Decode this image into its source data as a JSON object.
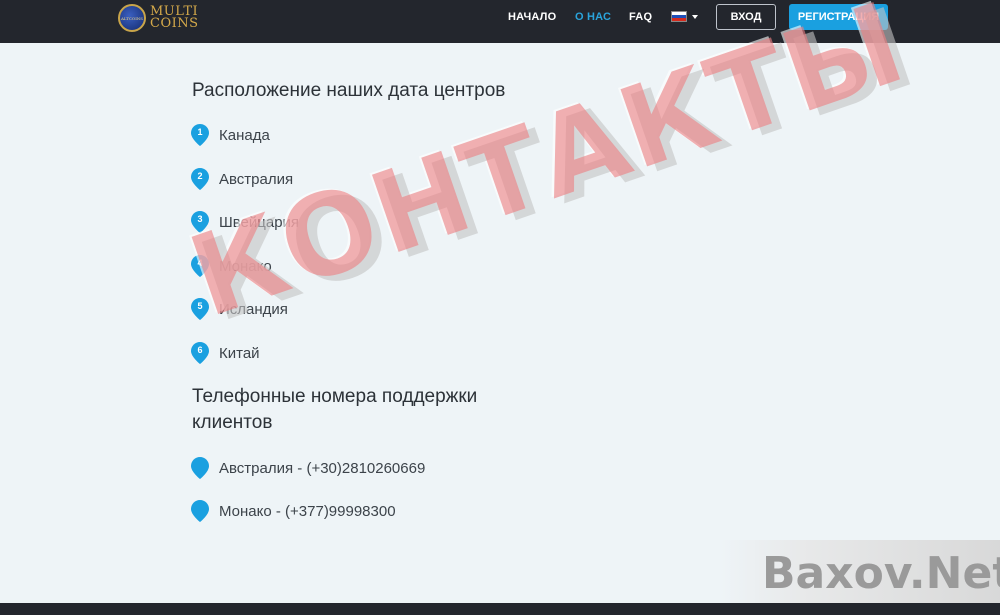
{
  "header": {
    "logo": {
      "line1": "MULTI",
      "line2": "COINS",
      "coin_text": "ALTCOINS"
    },
    "nav": [
      {
        "label": "НАЧАЛО",
        "active": false
      },
      {
        "label": "О НАС",
        "active": true
      },
      {
        "label": "FAQ",
        "active": false
      }
    ],
    "language": {
      "icon": "russia-flag-icon"
    },
    "login_label": "ВХОД",
    "register_label": "РЕГИСТРАЦИЯ"
  },
  "datacenters": {
    "title": "Расположение наших дата центров",
    "items": [
      {
        "num": "1",
        "label": "Канада"
      },
      {
        "num": "2",
        "label": "Австралия"
      },
      {
        "num": "3",
        "label": "Швейцария"
      },
      {
        "num": "4",
        "label": "Монако"
      },
      {
        "num": "5",
        "label": "Исландия"
      },
      {
        "num": "6",
        "label": "Китай"
      }
    ]
  },
  "support": {
    "title": "Телефонные номера поддержки клиентов",
    "items": [
      {
        "label": "Австралия - (+30)2810260669"
      },
      {
        "label": "Монако - (+377)99998300"
      }
    ]
  },
  "overlay": {
    "stamp": "КОНТАКТЫ",
    "brand": "Baxov.Net"
  },
  "colors": {
    "navbar": "#23262d",
    "accent": "#1aa0e0",
    "pin": "#1aa0e0",
    "background": "#eef4f7"
  }
}
